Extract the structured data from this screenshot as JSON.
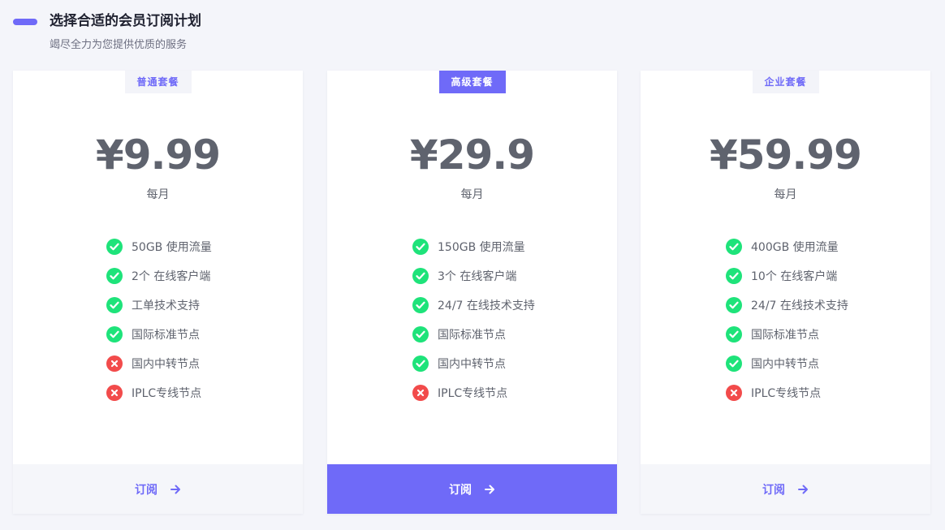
{
  "header": {
    "title": "选择合适的会员订阅计划",
    "subtitle": "竭尽全力为您提供优质的服务"
  },
  "colors": {
    "accent": "#6f6af8",
    "check": "#1ee37a",
    "cross": "#f24b4b",
    "background": "#f4f5fa"
  },
  "plans": [
    {
      "badge": "普通套餐",
      "price": "¥9.99",
      "period": "每月",
      "subscribe_label": "订阅",
      "features": [
        {
          "text": "50GB 使用流量",
          "included": true
        },
        {
          "text": "2个 在线客户端",
          "included": true
        },
        {
          "text": "工单技术支持",
          "included": true
        },
        {
          "text": "国际标准节点",
          "included": true
        },
        {
          "text": "国内中转节点",
          "included": false
        },
        {
          "text": "IPLC专线节点",
          "included": false
        }
      ]
    },
    {
      "badge": "高级套餐",
      "price": "¥29.9",
      "period": "每月",
      "subscribe_label": "订阅",
      "highlighted": true,
      "features": [
        {
          "text": "150GB 使用流量",
          "included": true
        },
        {
          "text": "3个 在线客户端",
          "included": true
        },
        {
          "text": "24/7 在线技术支持",
          "included": true
        },
        {
          "text": "国际标准节点",
          "included": true
        },
        {
          "text": "国内中转节点",
          "included": true
        },
        {
          "text": "IPLC专线节点",
          "included": false
        }
      ]
    },
    {
      "badge": "企业套餐",
      "price": "¥59.99",
      "period": "每月",
      "subscribe_label": "订阅",
      "features": [
        {
          "text": "400GB 使用流量",
          "included": true
        },
        {
          "text": "10个 在线客户端",
          "included": true
        },
        {
          "text": "24/7 在线技术支持",
          "included": true
        },
        {
          "text": "国际标准节点",
          "included": true
        },
        {
          "text": "国内中转节点",
          "included": true
        },
        {
          "text": "IPLC专线节点",
          "included": false
        }
      ]
    }
  ]
}
